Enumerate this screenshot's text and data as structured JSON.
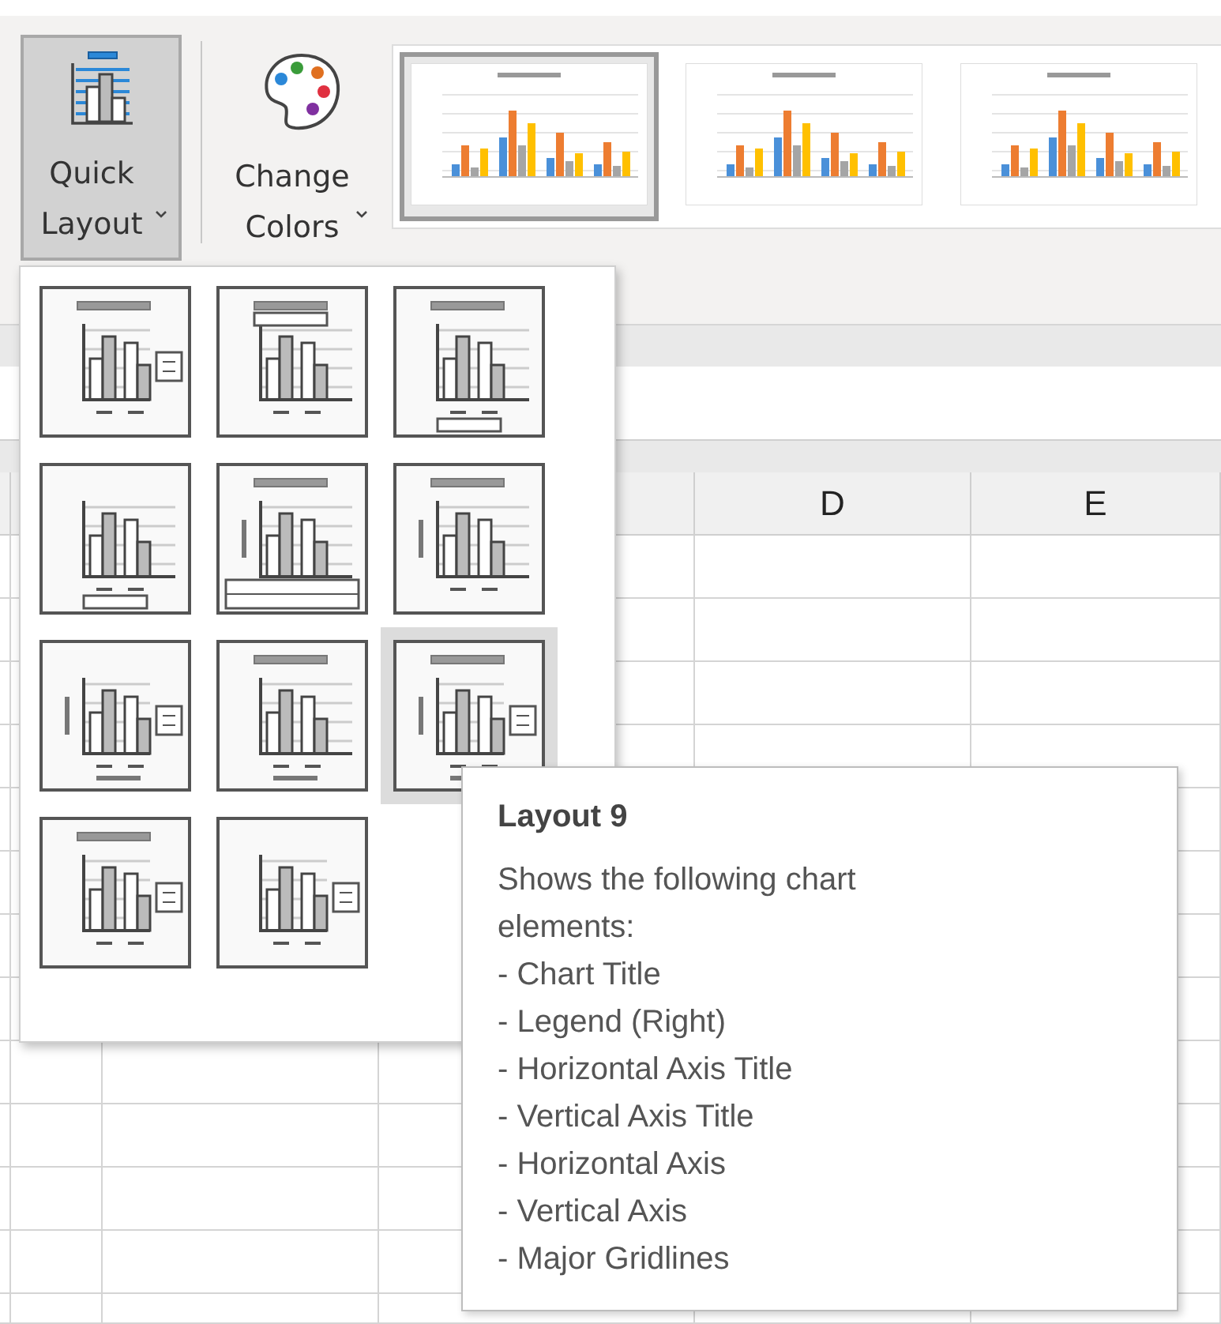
{
  "ribbon": {
    "buttons": [
      {
        "kind": "layout",
        "label": "Quick Layout",
        "active": true
      },
      {
        "kind": "colors",
        "label": "Change Colors",
        "active": false
      }
    ],
    "chart_styles": [
      {
        "selected": true
      },
      {
        "selected": false
      },
      {
        "selected": false
      }
    ]
  },
  "quick_layout_menu": {
    "layouts": [
      {
        "selected": false
      },
      {
        "selected": false
      },
      {
        "selected": false
      },
      {
        "selected": false
      },
      {
        "selected": false
      },
      {
        "selected": false
      },
      {
        "selected": false
      },
      {
        "selected": false
      },
      {
        "selected": true
      },
      {
        "selected": false
      },
      {
        "selected": false
      }
    ]
  },
  "tooltip": {
    "title": "Layout 9",
    "description": "Shows the following chart elements:",
    "items": [
      "- Chart Title",
      "- Legend (Right)",
      "- Horizontal Axis Title",
      "- Vertical Axis Title",
      "- Horizontal Axis",
      "- Vertical Axis",
      "- Major Gridlines"
    ]
  },
  "sheet": {
    "column_headers": [
      "D",
      "E"
    ]
  }
}
